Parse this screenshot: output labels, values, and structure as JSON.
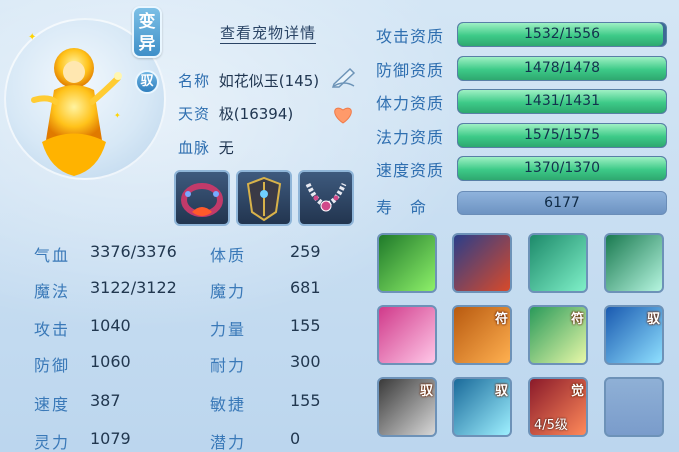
{
  "pet": {
    "variant_badge": "变异",
    "tame_badge": "驭",
    "detail_link": "查看宠物详情",
    "name_label": "名称",
    "name_value": "如花似玉(145)",
    "talent_label": "天资",
    "talent_value": "极(16394)",
    "bloodline_label": "血脉",
    "bloodline_value": "无"
  },
  "equipment": [
    {
      "name": "equip-collar"
    },
    {
      "name": "equip-armor"
    },
    {
      "name": "equip-necklace"
    }
  ],
  "stats": [
    {
      "label": "气血",
      "value": "3376/3376",
      "label2": "体质",
      "value2": "259"
    },
    {
      "label": "魔法",
      "value": "3122/3122",
      "label2": "魔力",
      "value2": "681"
    },
    {
      "label": "攻击",
      "value": "1040",
      "label2": "力量",
      "value2": "155"
    },
    {
      "label": "防御",
      "value": "1060",
      "label2": "耐力",
      "value2": "300"
    },
    {
      "label": "速度",
      "value": "387",
      "label2": "敏捷",
      "value2": "155"
    },
    {
      "label": "灵力",
      "value": "1079",
      "label2": "潜力",
      "value2": "0"
    }
  ],
  "aptitudes": [
    {
      "label": "攻击资质",
      "text": "1532/1556",
      "fill": 0.985
    },
    {
      "label": "防御资质",
      "text": "1478/1478",
      "fill": 1.0
    },
    {
      "label": "体力资质",
      "text": "1431/1431",
      "fill": 1.0
    },
    {
      "label": "法力资质",
      "text": "1575/1575",
      "fill": 1.0
    },
    {
      "label": "速度资质",
      "text": "1370/1370",
      "fill": 1.0
    }
  ],
  "lifespan": {
    "label": "寿　命",
    "value": "6177"
  },
  "skills": [
    {
      "name": "skill-1",
      "tag": "",
      "level": ""
    },
    {
      "name": "skill-2",
      "tag": "",
      "level": ""
    },
    {
      "name": "skill-3",
      "tag": "",
      "level": ""
    },
    {
      "name": "skill-4",
      "tag": "",
      "level": ""
    },
    {
      "name": "skill-5",
      "tag": "",
      "level": ""
    },
    {
      "name": "skill-6",
      "tag": "符",
      "level": ""
    },
    {
      "name": "skill-7",
      "tag": "符",
      "level": ""
    },
    {
      "name": "skill-8",
      "tag": "驭",
      "level": ""
    },
    {
      "name": "skill-9",
      "tag": "驭",
      "level": ""
    },
    {
      "name": "skill-10",
      "tag": "驭",
      "level": ""
    },
    {
      "name": "skill-11",
      "tag": "觉",
      "level": "4/5级"
    },
    {
      "name": "skill-empty",
      "tag": "",
      "level": ""
    }
  ]
}
